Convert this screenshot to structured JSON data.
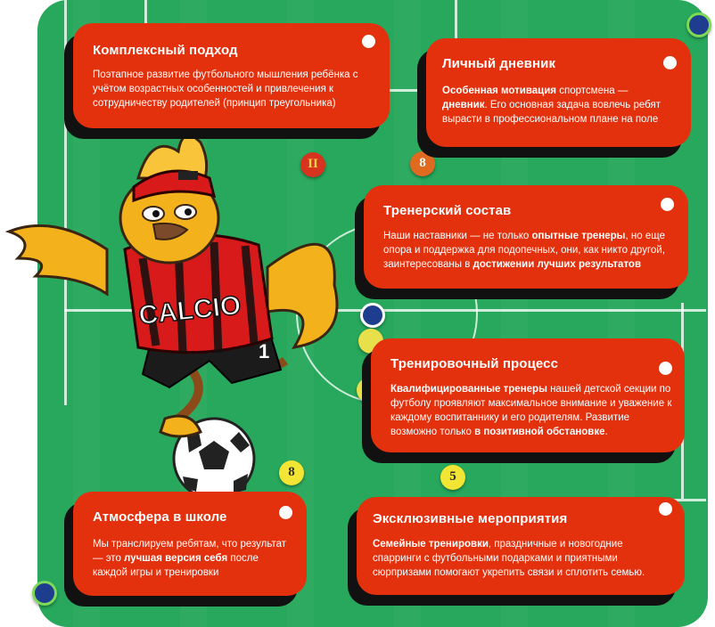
{
  "colors": {
    "field": "#27a85c",
    "card": "#e3300d",
    "card_shadow": "#111111",
    "text": "#ffffff",
    "jersey_red": "#d91a1a",
    "mascot_yellow": "#f3b21c"
  },
  "mascot": {
    "jersey_text": "CALCIO",
    "jersey_number": "1",
    "icon": "chicken-mascot-icon"
  },
  "discs": [
    {
      "label": "II",
      "color": "#d7341f",
      "text_color": "#ffd23f"
    },
    {
      "label": "8",
      "color": "#e06a20",
      "text_color": "#ffffff"
    },
    {
      "label": "",
      "color": "#1e3d8f",
      "text_color": "#ffffff"
    },
    {
      "label": "",
      "color": "#e8e04a",
      "text_color": "#ffffff"
    },
    {
      "label": "",
      "color": "#e8e04a",
      "text_color": "#ffffff"
    },
    {
      "label": "8",
      "color": "#f2e533",
      "text_color": "#2c2c2c"
    },
    {
      "label": "5",
      "color": "#f2e533",
      "text_color": "#2c2c2c"
    },
    {
      "label": "",
      "color": "#1e3d8f",
      "text_color": "#ffffff"
    },
    {
      "label": "",
      "color": "#1e3d8f",
      "text_color": "#ffffff"
    }
  ],
  "cards": {
    "complex": {
      "title": "Комплексный подход",
      "text": "Поэтапное развитие футбольного мышления ребёнка с учётом возрастных особенностей и привлечения к сотрудничеству родителей (принцип треугольника)"
    },
    "diary": {
      "title": "Личный дневник",
      "bold1": "Особенная мотивация",
      "text1": " спортсмена — ",
      "bold2": "дневник",
      "text2": ". Его основная задача вовлечь ребят вырасти в профессиональном плане на поле"
    },
    "coaches": {
      "title": "Тренерский состав",
      "text1": "Наши наставники — не только ",
      "bold1": "опытные тренеры",
      "text2": ", но еще опора и поддержка для подопечных, они, как никто другой, заинтересованы в ",
      "bold2": "достижении лучших результатов"
    },
    "training": {
      "title": "Тренировочный процесс",
      "bold1": "Квалифицированные тренеры",
      "text1": " нашей детской секции по футболу проявляют максимальное внимание и уважение к каждому воспитаннику и его родителям. Развитие возможно только ",
      "bold2": "в позитивной обстановке",
      "text2": "."
    },
    "atmosphere": {
      "title": "Атмосфера в школе",
      "text1": "Мы транслируем ребятам, что результат — это ",
      "bold1": "лучшая версия себя",
      "text2": " после каждой игры и тренировки"
    },
    "events": {
      "title": "Эксклюзивные мероприятия",
      "bold1": "Семейные тренировки",
      "text1": ", праздничные и новогодние спарринги с футбольными подарками и приятными сюрпризами помогают укрепить связи и сплотить семью."
    }
  }
}
